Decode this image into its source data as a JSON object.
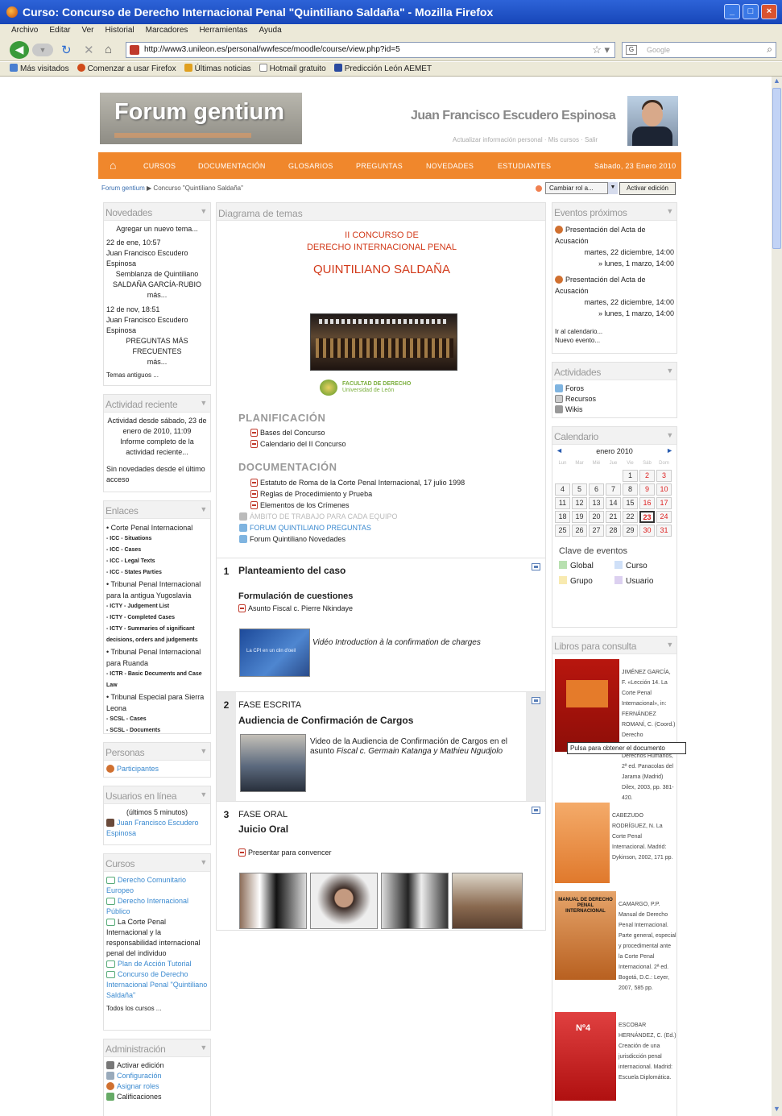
{
  "window": {
    "title": "Curso: Concurso de Derecho Internacional Penal \"Quintiliano Saldaña\" - Mozilla Firefox"
  },
  "menubar": [
    "Archivo",
    "Editar",
    "Ver",
    "Historial",
    "Marcadores",
    "Herramientas",
    "Ayuda"
  ],
  "nav": {
    "url": "http://www3.unileon.es/personal/wwfesce/moodle/course/view.php?id=5",
    "search_placeholder": "Google"
  },
  "bookmarks": [
    "Más visitados",
    "Comenzar a usar Firefox",
    "Últimas noticias",
    "Hotmail gratuito",
    "Predicción León AEMET"
  ],
  "header": {
    "logo": "Forum gentium",
    "user": "Juan Francisco Escudero Espinosa",
    "user_links": "Actualizar información personal · Mis cursos · Salir",
    "nav": [
      "CURSOS",
      "DOCUMENTACIÓN",
      "GLOSARIOS",
      "PREGUNTAS",
      "NOVEDADES",
      "ESTUDIANTES"
    ],
    "date": "Sábado, 23 Enero 2010"
  },
  "breadcrumb": {
    "home": "Forum gentium",
    "sep": "▶",
    "current": "Concurso \"Quintiliano Saldaña\""
  },
  "role": {
    "select": "Cambiar rol a...",
    "edit": "Activar edición"
  },
  "left": {
    "novedades": {
      "title": "Novedades",
      "add": "Agregar un nuevo tema...",
      "p1_date": "22 de ene, 10:57",
      "p1_author": "Juan Francisco Escudero Espinosa",
      "p1_text": "Semblanza de Quintiliano SALDAÑA GARCÍA-RUBIO",
      "p1_more": "más...",
      "p2_date": "12 de nov, 18:51",
      "p2_author": "Juan Francisco Escudero Espinosa",
      "p2_text": "PREGUNTAS MÁS FRECUENTES",
      "p2_more": "más...",
      "older": "Temas antiguos ..."
    },
    "actividad": {
      "title": "Actividad reciente",
      "since": "Actividad desde sábado, 23 de enero de 2010, 11:09",
      "report": "Informe completo de la actividad reciente...",
      "none": "Sin novedades desde el último acceso"
    },
    "enlaces": {
      "title": "Enlaces",
      "items": [
        {
          "t": "• Corte Penal Internacional",
          "s": "n"
        },
        {
          "t": "- ICC - Situations",
          "s": "s"
        },
        {
          "t": "- ICC - Cases",
          "s": "s"
        },
        {
          "t": "- ICC - Legal Texts",
          "s": "s"
        },
        {
          "t": "- ICC - States Parties",
          "s": "s"
        },
        {
          "t": "• Tribunal Penal Internacional para la antigua Yugoslavia",
          "s": "n"
        },
        {
          "t": "- ICTY - Judgement List",
          "s": "s"
        },
        {
          "t": "- ICTY - Completed Cases",
          "s": "s"
        },
        {
          "t": "- ICTY - Summaries of significant decisions, orders and judgements",
          "s": "s"
        },
        {
          "t": "• Tribunal Penal Internacional para Ruanda",
          "s": "n"
        },
        {
          "t": "- ICTR - Basic Documents and Case Law",
          "s": "s"
        },
        {
          "t": "• Tribunal Especial para Sierra Leona",
          "s": "n"
        },
        {
          "t": "- SCSL - Cases",
          "s": "s"
        },
        {
          "t": "- SCSL - Documents",
          "s": "s"
        }
      ]
    },
    "personas": {
      "title": "Personas",
      "item": "Participantes"
    },
    "usuarios": {
      "title": "Usuarios en línea",
      "window": "(últimos 5 minutos)",
      "user": "Juan Francisco Escudero Espinosa"
    },
    "cursos": {
      "title": "Cursos",
      "items": [
        "Derecho Comunitario Europeo",
        "Derecho Internacional Público",
        "La Corte Penal Internacional y la responsabilidad internacional penal del individuo",
        "Plan de Acción Tutorial",
        "Concurso de Derecho Internacional Penal \"Quintiliano Saldaña\""
      ],
      "all": "Todos los cursos ..."
    },
    "admin": {
      "title": "Administración",
      "items": [
        "Activar edición",
        "Configuración",
        "Asignar roles",
        "Calificaciones"
      ]
    }
  },
  "center": {
    "title": "Diagrama de temas",
    "contest": {
      "l1": "II CONCURSO DE",
      "l2": "DERECHO INTERNACIONAL PENAL",
      "l3": "QUINTILIANO SALDAÑA"
    },
    "faculty": "FACULTAD DE DERECHO",
    "faculty_sub": "Universidad de León",
    "planificacion": {
      "title": "PLANIFICACIÓN",
      "items": [
        "Bases del Concurso",
        "Calendario del II Concurso"
      ]
    },
    "documentacion": {
      "title": "DOCUMENTACIÓN",
      "items": [
        "Estatuto de Roma de la Corte Penal Internacional, 17 julio 1998",
        "Reglas de Procedimiento y Prueba",
        "Elementos de los Crímenes"
      ],
      "faded": "ÁMBITO DE TRABAJO PARA CADA EQUIPO",
      "forum1": "FORUM QUINTILIANO PREGUNTAS",
      "forum2": "Forum Quintiliano Novedades"
    },
    "t1": {
      "num": "1",
      "title": "Planteamiento del caso",
      "sub": "Formulación de cuestiones",
      "doc": "Asunto Fiscal c. Pierre Nkindaye",
      "thumb": "La CPI en un clin d'oeil",
      "video": "Vidéo Introduction à la confirmation de charges"
    },
    "t2": {
      "num": "2",
      "head": "FASE ESCRITA",
      "title": "Audiencia de Confirmación de Cargos",
      "video_a": "Video de la Audiencia de Confirmación de Cargos en el asunto ",
      "video_b": "Fiscal c. Germain Katanga y Mathieu Ngudjolo"
    },
    "t3": {
      "num": "3",
      "head": "FASE ORAL",
      "title": "Juicio Oral",
      "doc": "Presentar para convencer"
    }
  },
  "right": {
    "eventos": {
      "title": "Eventos próximos",
      "ev1": "Presentación del Acta de Acusación",
      "ev1_d1": "martes, 22 diciembre, 14:00",
      "ev1_d2": "» lunes, 1 marzo, 14:00",
      "ev2": "Presentación del Acta de Acusación",
      "ev2_d1": "martes, 22 diciembre, 14:00",
      "ev2_d2": "» lunes, 1 marzo, 14:00",
      "cal": "Ir al calendario...",
      "new": "Nuevo evento..."
    },
    "actividades": {
      "title": "Actividades",
      "items": [
        "Foros",
        "Recursos",
        "Wikis"
      ]
    },
    "calendario": {
      "title": "Calendario",
      "month": "enero 2010",
      "prev": "◄",
      "next": "►",
      "days": [
        "Lun",
        "Mar",
        "Mié",
        "Jue",
        "Vie",
        "Sáb",
        "Dom"
      ],
      "cells": [
        "",
        "",
        "",
        "",
        "1",
        "2",
        "3",
        "4",
        "5",
        "6",
        "7",
        "8",
        "9",
        "10",
        "11",
        "12",
        "13",
        "14",
        "15",
        "16",
        "17",
        "18",
        "19",
        "20",
        "21",
        "22",
        "23",
        "24",
        "25",
        "26",
        "27",
        "28",
        "29",
        "30",
        "31"
      ],
      "today": "23",
      "key_title": "Clave de eventos",
      "keys": [
        "Global",
        "Curso",
        "Grupo",
        "Usuario"
      ]
    },
    "libros": {
      "title": "Libros para consulta",
      "tooltip": "Pulsa para obtener el documento",
      "b1": "JIMÉNEZ GARCÍA, F. «Lección 14. La Corte Penal Internacional», in: FERNÁNDEZ ROMANÍ, C. (Coord.) Derecho Internacional de los Derechos Humanos, 2ª ed. Panacolas del Jarama (Madrid) Dilex, 2003, pp. 381-420.",
      "b2": "CABEZUDO RODRÍGUEZ, N. La Corte Penal Internacional. Madrid: Dykinson, 2002, 171 pp.",
      "b3": "CAMARGO, P.P. Manual de Derecho Penal Internacional. Parte general, especial y procedimental ante la Corte Penal Internacional. 2ª ed. Bogotá, D.C.: Leyer, 2007, 585 pp.",
      "b3_cover": "MANUAL DE DERECHO PENAL INTERNACIONAL",
      "b4": "ESCOBAR HERNÁNDEZ, C. (Ed.) Creación de una jurisdicción penal internacional. Madrid: Escuela Diplomática.",
      "b4_cover": "Nº4"
    }
  },
  "colors": {
    "accent": "#f0872c",
    "link": "#3b8ad0",
    "red": "#d23a1a",
    "title_blue": "#1746b8"
  }
}
